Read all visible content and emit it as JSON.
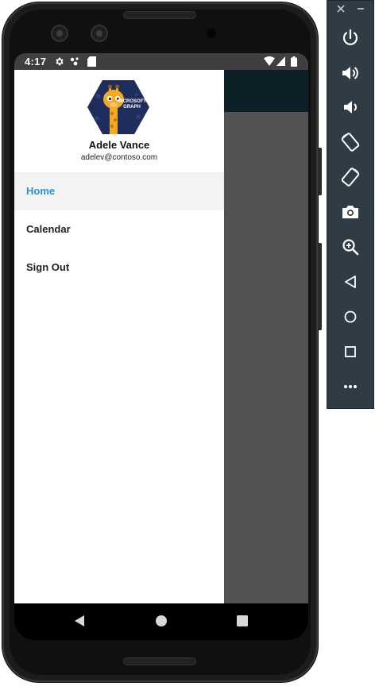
{
  "status_bar": {
    "time": "4:17"
  },
  "drawer": {
    "avatar_text": "MICROSOFT GRAPH",
    "user_name": "Adele Vance",
    "user_email": "adelev@contoso.com",
    "menu": [
      {
        "label": "Home",
        "active": true
      },
      {
        "label": "Calendar",
        "active": false
      },
      {
        "label": "Sign Out",
        "active": false
      }
    ]
  },
  "colors": {
    "app_bar": "#0d2027",
    "active_item": "#2f8fd5",
    "scrim": "#525252",
    "toolbar": "#2f3b45"
  },
  "emulator_toolbar": {
    "window_controls": [
      "close-icon",
      "minimize-icon"
    ],
    "buttons": [
      "power-icon",
      "volume-up-icon",
      "volume-down-icon",
      "rotate-left-icon",
      "rotate-right-icon",
      "camera-icon",
      "zoom-icon",
      "back-icon",
      "home-icon",
      "overview-icon",
      "more-icon"
    ]
  }
}
